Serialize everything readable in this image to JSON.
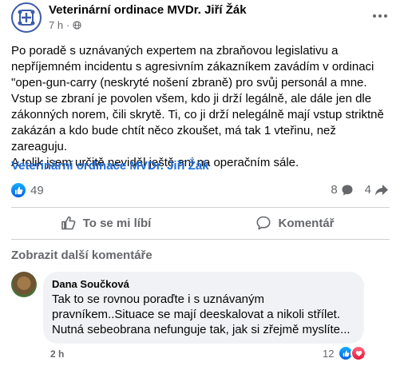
{
  "post": {
    "page_name": "Veterinární ordinace MVDr. Jiří Žák",
    "time": "7 h",
    "time_separator": "·",
    "text": "Po poradě s uznávaných expertem na zbraňovou legislativu a\nnepříjemném incidentu s agresivním zákazníkem zavádím v ordinaci\n\"open-gun-carry (neskryté nošení zbraně) pro svůj personál a mne.\nVstup se zbraní je povolen všem, kdo ji drží legálně, ale dále jen dle\nzákonných norem, čili skrytě. Ti, co ji drží nelegálně mají vstup striktně\nzakázán a kdo bude chtít něco zkoušet, má tak 1 vteřinu, než zareaguju.\nA tolik jsem určitě neviděl ještě ani na operačním sále.",
    "signature": "Veterinární ordinace MVDr. Jiří Žák"
  },
  "stats": {
    "reactions": "49",
    "comments": "8",
    "shares": "4"
  },
  "actions": {
    "like": "To se mi líbí",
    "comment": "Komentář"
  },
  "comments_section": {
    "view_more": "Zobrazit další komentáře",
    "comment": {
      "author": "Dana Součková",
      "text": "Tak to se rovnou poraďte i s uznávaným\npravníkem..Situace se mají deeskalovat a nikoli střílet.\nNutná sebeobrana nefunguje tak, jak si zřejmě myslíte...",
      "time": "2 h",
      "reaction_count": "12"
    }
  },
  "colors": {
    "accent": "#216fdb",
    "secondary_text": "#65676b",
    "divider": "#ced0d4",
    "bubble": "#f0f2f5"
  }
}
